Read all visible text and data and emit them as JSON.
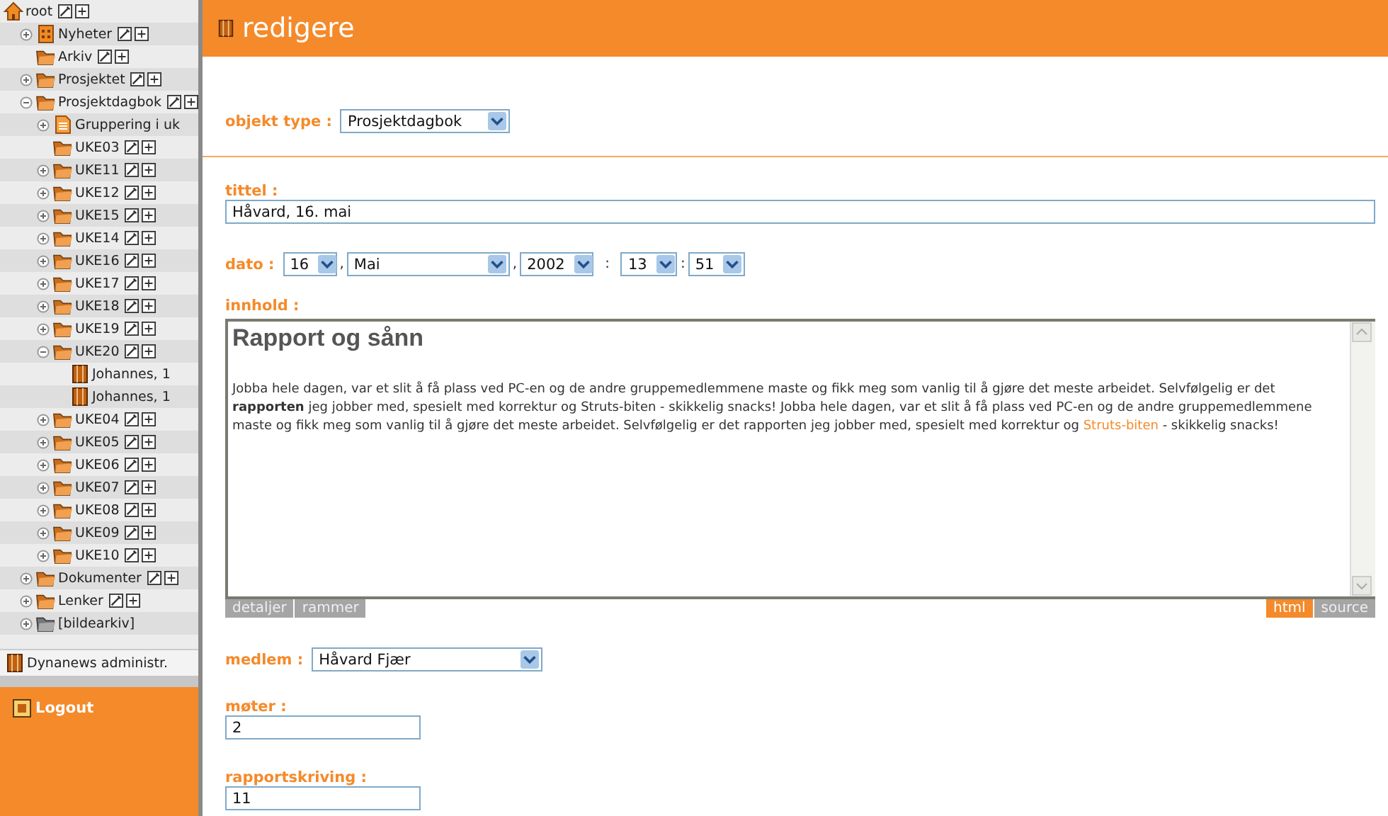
{
  "sidebar": {
    "tree": {
      "label": "root",
      "kind": "home",
      "actions": true,
      "children": [
        {
          "label": "Nyheter",
          "kind": "news",
          "expanded": false,
          "actions": true
        },
        {
          "label": "Arkiv",
          "kind": "folder",
          "actions": true
        },
        {
          "label": "Prosjektet",
          "kind": "folder",
          "expanded": false,
          "actions": true
        },
        {
          "label": "Prosjektdagbok",
          "kind": "folder",
          "expanded": true,
          "actions": true,
          "children": [
            {
              "label": "Gruppering i uk",
              "kind": "document",
              "expanded": false,
              "actions": false
            },
            {
              "label": "UKE03",
              "kind": "folder",
              "actions": true
            },
            {
              "label": "UKE11",
              "kind": "folder",
              "expanded": false,
              "actions": true
            },
            {
              "label": "UKE12",
              "kind": "folder",
              "expanded": false,
              "actions": true
            },
            {
              "label": "UKE15",
              "kind": "folder",
              "expanded": false,
              "actions": true
            },
            {
              "label": "UKE14",
              "kind": "folder",
              "expanded": false,
              "actions": true
            },
            {
              "label": "UKE16",
              "kind": "folder",
              "expanded": false,
              "actions": true
            },
            {
              "label": "UKE17",
              "kind": "folder",
              "expanded": false,
              "actions": true
            },
            {
              "label": "UKE18",
              "kind": "folder",
              "expanded": false,
              "actions": true
            },
            {
              "label": "UKE19",
              "kind": "folder",
              "expanded": false,
              "actions": true
            },
            {
              "label": "UKE20",
              "kind": "folder",
              "expanded": true,
              "actions": true,
              "children": [
                {
                  "label": "Johannes, 1",
                  "kind": "book",
                  "actions": false
                },
                {
                  "label": "Johannes, 1",
                  "kind": "book",
                  "actions": false
                }
              ]
            },
            {
              "label": "UKE04",
              "kind": "folder",
              "expanded": false,
              "actions": true
            },
            {
              "label": "UKE05",
              "kind": "folder",
              "expanded": false,
              "actions": true
            },
            {
              "label": "UKE06",
              "kind": "folder",
              "expanded": false,
              "actions": true
            },
            {
              "label": "UKE07",
              "kind": "folder",
              "expanded": false,
              "actions": true
            },
            {
              "label": "UKE08",
              "kind": "folder",
              "expanded": false,
              "actions": true
            },
            {
              "label": "UKE09",
              "kind": "folder",
              "expanded": false,
              "actions": true
            },
            {
              "label": "UKE10",
              "kind": "folder",
              "expanded": false,
              "actions": true
            }
          ]
        },
        {
          "label": "Dokumenter",
          "kind": "folder",
          "expanded": false,
          "actions": true
        },
        {
          "label": "Lenker",
          "kind": "folder",
          "expanded": false,
          "actions": true
        },
        {
          "label": "[bildearkiv]",
          "kind": "archive",
          "expanded": false,
          "actions": false
        }
      ]
    },
    "admin_link": "Dynanews administr.",
    "logout": "Logout"
  },
  "header": {
    "title": "redigere"
  },
  "form": {
    "object_type": {
      "label": "objekt type :",
      "value": "Prosjektdagbok"
    },
    "title": {
      "label": "tittel :",
      "value": "Håvard, 16. mai"
    },
    "date": {
      "label": "dato :",
      "day": "16",
      "month": "Mai",
      "year": "2002",
      "hour": "13",
      "minute": "51",
      "separators": [
        ",",
        ",",
        ":",
        ":"
      ]
    },
    "content": {
      "label": "innhold :",
      "heading": "Rapport og sånn",
      "before": "Jobba hele dagen, var et slit å få plass ved PC-en og de andre gruppemedlemmene maste og fikk meg som vanlig til å gjøre det meste arbeidet. Selvfølgelig er det **rapporten** jeg jobber med, spesielt med korrektur og Struts-biten - skikkelig snacks! Jobba hele dagen, var et slit å få plass ved PC-en og de andre gruppemedlemmene maste og fikk meg som vanlig til å gjøre det meste arbeidet. Selvfølgelig er det rapporten jeg jobber med, spesielt med korrektur og ",
      "link": "Struts-biten",
      "after": " - skikkelig snacks!",
      "left_tabs": [
        {
          "label": "detaljer",
          "selected": false
        },
        {
          "label": "rammer",
          "selected": false
        }
      ],
      "right_tabs": [
        {
          "label": "html",
          "selected": true
        },
        {
          "label": "source",
          "selected": false
        }
      ]
    },
    "member": {
      "label": "medlem :",
      "value": "Håvard Fjær"
    },
    "meetings": {
      "label": "møter :",
      "value": "2"
    },
    "report_writing": {
      "label": "rapportskriving :",
      "value": "11"
    }
  }
}
